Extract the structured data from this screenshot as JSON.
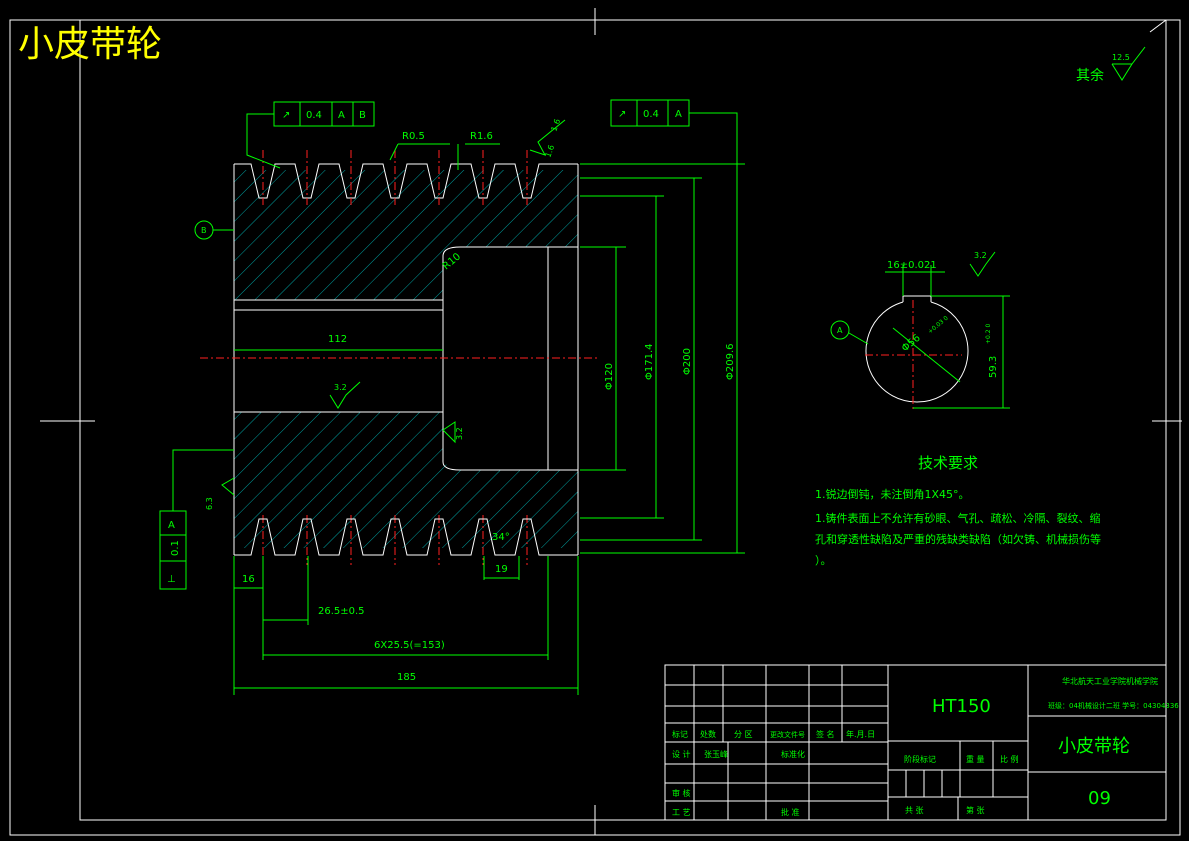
{
  "drawing": {
    "corner_title": "小皮带轮",
    "roughness_note": "其余",
    "roughness_value": "12.5"
  },
  "tolerance_frames": {
    "left": {
      "symbol": "↗",
      "value": "0.4",
      "datum1": "A",
      "datum2": "B"
    },
    "right": {
      "symbol": "↗",
      "value": "0.4",
      "datum1": "A"
    },
    "perp": {
      "symbol": "⊥",
      "value": "0.1",
      "datum": "A"
    }
  },
  "datum_labels": {
    "b": "B",
    "a": "A"
  },
  "dimensions": {
    "r05": "R0.5",
    "r16": "R1.6",
    "r10": "R10",
    "d112": "112",
    "d120": "Φ120",
    "d1714": "Φ171.4",
    "d200": "Φ200",
    "d2096": "Φ209.6",
    "pitch": "26.5±0.5",
    "pitch_total": "6X25.5(=153)",
    "d16": "16",
    "d185": "185",
    "d19": "19",
    "angle": "34°",
    "key_width": "16±0.021",
    "bore": "Φ56",
    "bore_tol": "+0.03\n0",
    "key_depth": "59.3",
    "key_depth_tol": "+0.2\n0",
    "rough_32a": "3.2",
    "rough_32b": "3.2",
    "rough_32c": "3.2",
    "rough_32d": "3.2",
    "rough_63": "6.3",
    "rough_16a": "1.6",
    "rough_16b": "1.6"
  },
  "tech_requirements": {
    "heading": "技术要求",
    "line1": "1.锐边倒钝，未注倒角1X45°。",
    "line2": "1.铸件表面上不允许有砂眼、气孔、疏松、冷隔、裂纹、缩",
    "line3": "孔和穿透性缺陷及严重的残缺类缺陷（如欠铸、机械损伤等",
    "line4": "）。"
  },
  "title_block": {
    "material": "HT150",
    "school": "华北航天工业学院机械学院",
    "class_info": "班级：04机械设计二班 学号：04304336",
    "part_name": "小皮带轮",
    "drawing_no": "09",
    "h_mark": "标记",
    "h_count": "处数",
    "h_zone": "分 区",
    "h_docno": "更改文件号",
    "h_sign": "签 名",
    "h_date": "年.月.日",
    "h_design": "设 计",
    "designer": "张玉峰",
    "h_std": "标准化",
    "h_check": "审 核",
    "h_craft": "工 艺",
    "h_approve": "批 准",
    "h_stage": "阶段标记",
    "h_weight": "重 量",
    "h_scale": "比 例",
    "h_total": "共    张",
    "h_sheet": "第    张"
  },
  "colors": {
    "outline": "#ffffff",
    "dimension": "#00ff00",
    "hatch": "#00c8c8",
    "center": "#ff2020",
    "title": "#ffff00"
  }
}
